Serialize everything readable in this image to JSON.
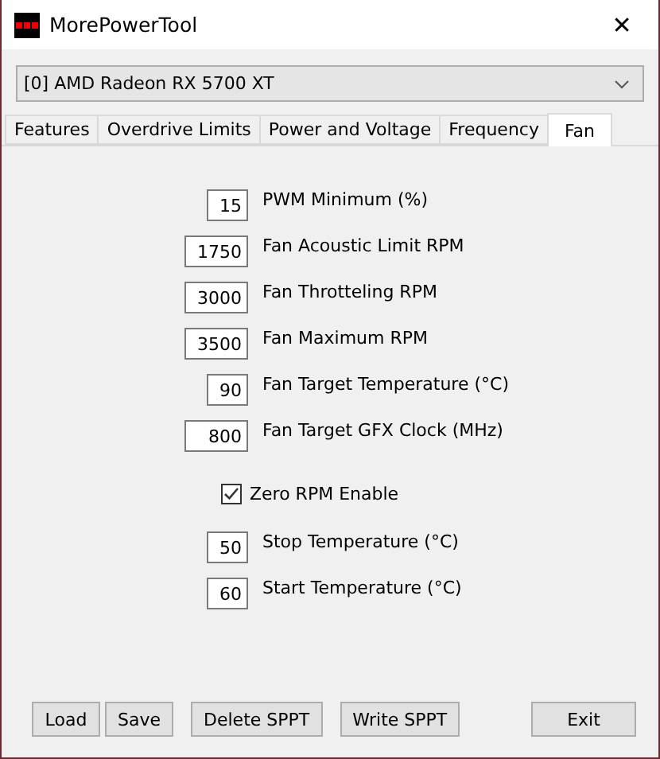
{
  "window": {
    "title": "MorePowerTool",
    "close": "✕"
  },
  "device_dropdown": {
    "value": "[0] AMD Radeon RX 5700 XT"
  },
  "tabs": [
    {
      "label": "Features",
      "selected": false
    },
    {
      "label": "Overdrive Limits",
      "selected": false
    },
    {
      "label": "Power and Voltage",
      "selected": false
    },
    {
      "label": "Frequency",
      "selected": false
    },
    {
      "label": "Fan",
      "selected": true
    }
  ],
  "settings": [
    {
      "kind": "field",
      "value": "15",
      "label": "PWM Minimum (%)"
    },
    {
      "kind": "field",
      "value": "1750",
      "label": "Fan Acoustic Limit RPM"
    },
    {
      "kind": "field",
      "value": "3000",
      "label": "Fan Throtteling RPM"
    },
    {
      "kind": "field",
      "value": "3500",
      "label": "Fan Maximum RPM"
    },
    {
      "kind": "field",
      "value": "90",
      "label": "Fan Target Temperature (°C)"
    },
    {
      "kind": "field",
      "value": "800",
      "label": "Fan Target GFX Clock (MHz)"
    },
    {
      "kind": "checkbox",
      "checked": true,
      "label": "Zero RPM Enable"
    },
    {
      "kind": "field",
      "value": "50",
      "label": "Stop Temperature (°C)"
    },
    {
      "kind": "field",
      "value": "60",
      "label": "Start Temperature (°C)"
    }
  ],
  "buttons": [
    {
      "label": "Load",
      "kind": "left"
    },
    {
      "label": "Save",
      "kind": "left"
    },
    {
      "label": "Delete SPPT",
      "kind": "mid"
    },
    {
      "label": "Write SPPT",
      "kind": "mid"
    },
    {
      "label": "Exit",
      "kind": "right"
    }
  ]
}
